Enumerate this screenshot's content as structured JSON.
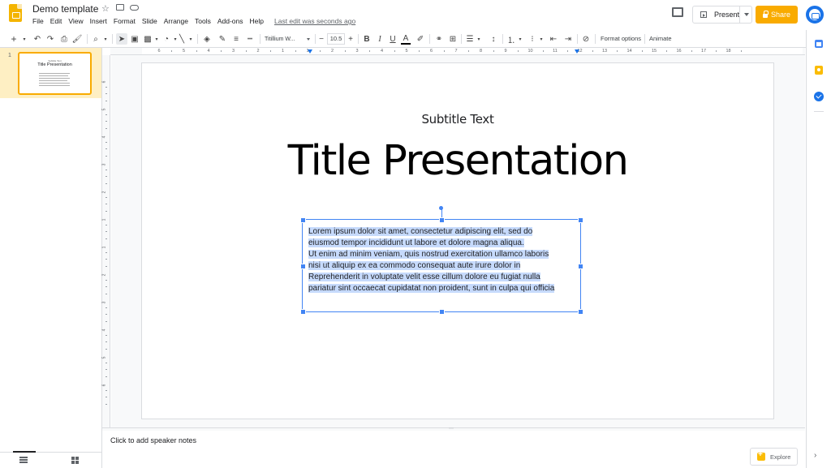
{
  "header": {
    "doc_title": "Demo template",
    "menu": [
      "File",
      "Edit",
      "View",
      "Insert",
      "Format",
      "Slide",
      "Arrange",
      "Tools",
      "Add-ons",
      "Help"
    ],
    "last_edit": "Last edit was seconds ago",
    "present_label": "Present",
    "share_label": "Share"
  },
  "toolbar": {
    "font": "Titillium W...",
    "font_size": "10.5",
    "format_options": "Format options",
    "animate": "Animate"
  },
  "filmstrip": {
    "slide_number": "1",
    "thumb_subtitle": "Subtitle Text",
    "thumb_title": "Title Presentation"
  },
  "ruler": {
    "h_labels": [
      "6",
      "5",
      "4",
      "3",
      "2",
      "1",
      "1",
      "2",
      "3",
      "4",
      "5",
      "6",
      "7",
      "8",
      "9",
      "10",
      "11",
      "12",
      "13",
      "14",
      "15",
      "16",
      "17",
      "18"
    ],
    "v_labels": [
      "6",
      "5",
      "4",
      "3",
      "2",
      "1",
      "1",
      "2",
      "3",
      "4",
      "5",
      "6"
    ]
  },
  "slide": {
    "subtitle": "Subtitle Text",
    "title": "Title Presentation",
    "body_lines": [
      "Lorem ipsum dolor sit amet, consectetur adipiscing elit, sed do",
      "eiusmod tempor incididunt ut labore et dolore magna aliqua.",
      "Ut enim ad minim veniam, quis nostrud exercitation ullamco laboris",
      "nisi ut aliquip ex ea commodo consequat aute irure dolor in",
      "Reprehenderit in voluptate velit esse cillum dolore eu fugiat nulla",
      "pariatur sint occaecat cupidatat non proident, sunt in culpa qui officia"
    ]
  },
  "notes": {
    "placeholder": "Click to add speaker notes"
  },
  "explore_label": "Explore",
  "colors": {
    "accent": "#f9ab00",
    "selection": "#4285f4",
    "highlight": "#c6dafc",
    "slide_bg": "#ffffff",
    "canvas_bg": "#f8f9fa"
  },
  "icons": [
    "docs-slides-logo",
    "star-icon",
    "move-folder-icon",
    "cloud-saved-icon",
    "comments-icon",
    "present-icon",
    "lock-icon",
    "account-avatar",
    "calendar-icon",
    "keep-icon",
    "tasks-icon",
    "explore-icon",
    "list-view-icon",
    "grid-view-icon"
  ]
}
